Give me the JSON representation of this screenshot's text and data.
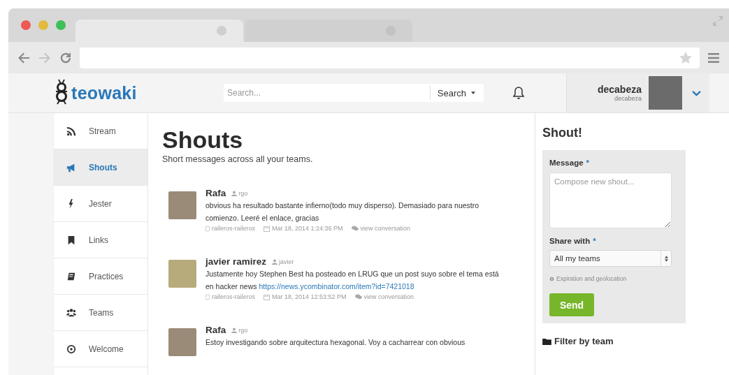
{
  "browser": {
    "tabs": [
      {
        "selected": true
      },
      {
        "selected": false
      }
    ]
  },
  "header": {
    "logo": "teowaki",
    "search": {
      "placeholder": "Search...",
      "button": "Search"
    },
    "user": {
      "name": "decabeza",
      "handle": "decabeza"
    }
  },
  "sidebar": {
    "items": [
      {
        "label": "Stream",
        "selected": false
      },
      {
        "label": "Shouts",
        "selected": true
      },
      {
        "label": "Jester",
        "selected": false
      },
      {
        "label": "Links",
        "selected": false
      },
      {
        "label": "Practices",
        "selected": false
      },
      {
        "label": "Teams",
        "selected": false
      },
      {
        "label": "Welcome",
        "selected": false
      }
    ]
  },
  "main": {
    "title": "Shouts",
    "subtitle": "Short messages across all your teams.",
    "shouts": [
      {
        "author": "Rafa",
        "handle": "rgo",
        "text": "obvious ha resultado bastante infierno(todo muy disperso). Demasiado para nuestro comienzo. Leeré el enlace, gracias",
        "team": "raileros-raileros",
        "date": "Mar 18, 2014 1:24:36 PM",
        "action": "view conversation"
      },
      {
        "author": "javier ramirez",
        "handle": "javier",
        "text": "Justamente hoy Stephen Best ha posteado en LRUG que un post suyo sobre el tema está en hacker news",
        "link": "https://news.ycombinator.com/item?id=7421018",
        "team": "raileros-raileros",
        "date": "Mar 18, 2014 12:53:52 PM",
        "action": "view conversation"
      },
      {
        "author": "Rafa",
        "handle": "rgo",
        "text": "Estoy investigando sobre arquitectura hexagonal. Voy a cacharrear con obvious"
      }
    ]
  },
  "shout_form": {
    "title": "Shout!",
    "message_label": "Message",
    "message_required": "*",
    "message_placeholder": "Compose new shout...",
    "share_label": "Share with",
    "share_required": "*",
    "share_value": "All my teams",
    "options_link": "Expiration and geolocation",
    "submit": "Send",
    "filter_title": "Filter by team"
  }
}
